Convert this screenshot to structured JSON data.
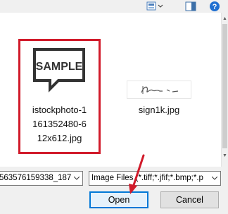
{
  "toolbar": {
    "view_icon": "change-view-icon",
    "preview_icon": "preview-pane-icon",
    "help_icon": "help-icon"
  },
  "files": [
    {
      "name": "istockphoto-1\n161352480-6\n12x612.jpg",
      "thumbnail_text": "SAMPLE",
      "selected": true
    },
    {
      "name": "sign1k.jpg",
      "thumbnail_text": "",
      "selected": false
    }
  ],
  "filename_field": {
    "value": "563576159338_187"
  },
  "filetype_field": {
    "value": "Image Files (*.tiff;*.jfif;*.bmp;*.p"
  },
  "buttons": {
    "open": "Open",
    "cancel": "Cancel"
  },
  "colors": {
    "selection_highlight": "#d11a2a",
    "annotation_arrow": "#d11a2a",
    "default_button_border": "#0078d7"
  }
}
